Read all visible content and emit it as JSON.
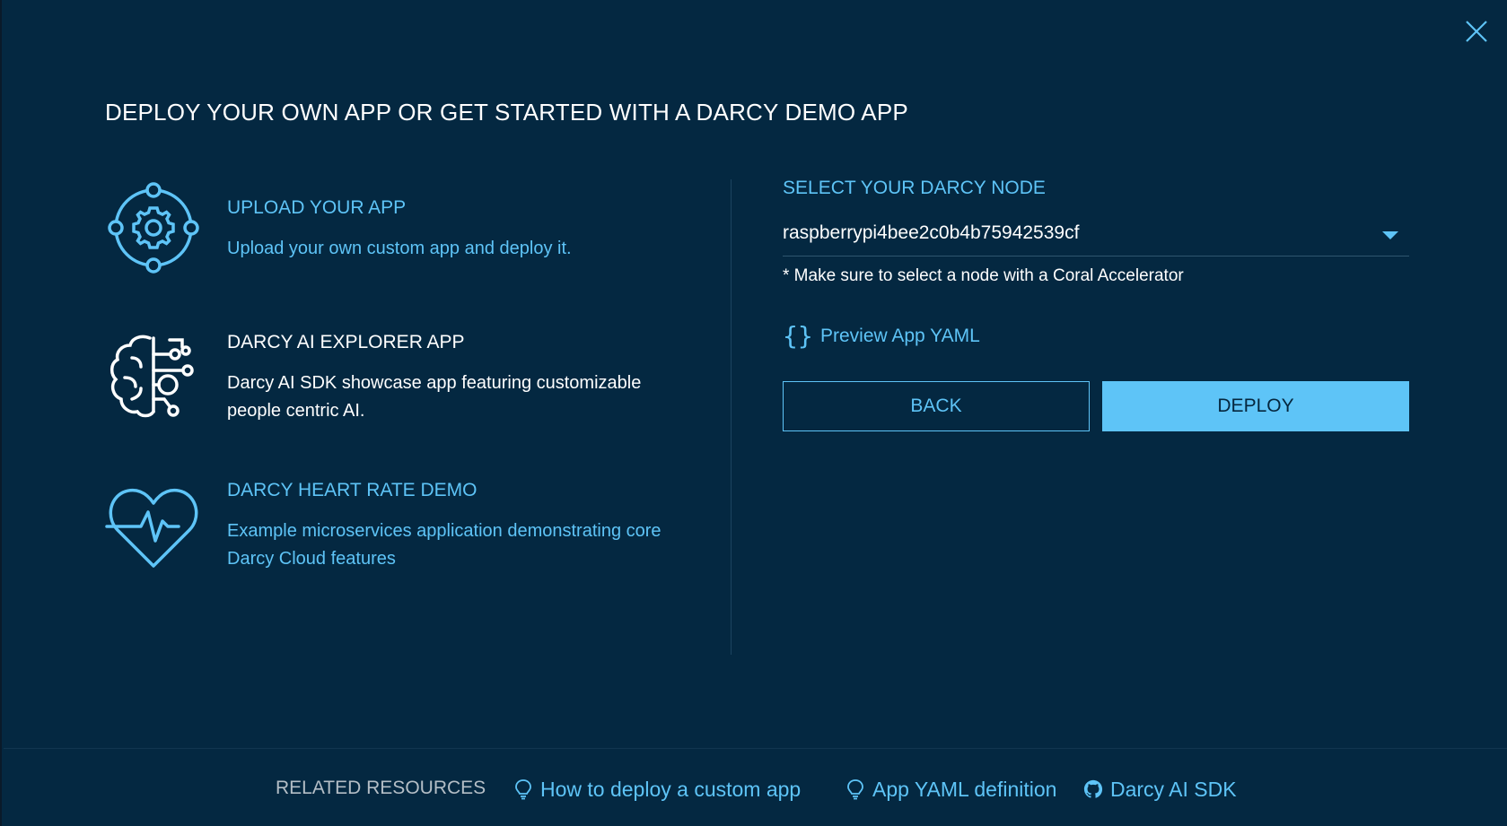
{
  "modal": {
    "title": "DEPLOY YOUR OWN APP OR GET STARTED WITH A DARCY DEMO APP",
    "close_icon": "close-icon"
  },
  "options": [
    {
      "icon": "gear-target-icon",
      "title": "UPLOAD YOUR APP",
      "description": "Upload your own custom app and deploy it."
    },
    {
      "icon": "brain-circuit-icon",
      "title": "DARCY AI EXPLORER APP",
      "description": "Darcy AI SDK showcase app featuring customizable people centric AI."
    },
    {
      "icon": "heart-pulse-icon",
      "title": "DARCY HEART RATE DEMO",
      "description": "Example microservices application demonstrating core Darcy Cloud features"
    }
  ],
  "node": {
    "label": "SELECT YOUR DARCY NODE",
    "selected": "raspberrypi4bee2c0b4b75942539cf",
    "hint": "* Make sure to select a node with a Coral Accelerator"
  },
  "preview": {
    "braces": "{}",
    "label": "Preview App YAML"
  },
  "buttons": {
    "back": "BACK",
    "deploy": "DEPLOY"
  },
  "footer": {
    "label": "RELATED RESOURCES",
    "links": [
      {
        "icon": "lightbulb-icon",
        "text": "How to deploy a custom app"
      },
      {
        "icon": "lightbulb-icon",
        "text": "App YAML definition"
      },
      {
        "icon": "github-icon",
        "text": "Darcy AI SDK"
      }
    ]
  },
  "colors": {
    "background": "#042841",
    "accent": "#5ec4f7",
    "text": "#ffffff",
    "muted": "#b4bec6"
  }
}
